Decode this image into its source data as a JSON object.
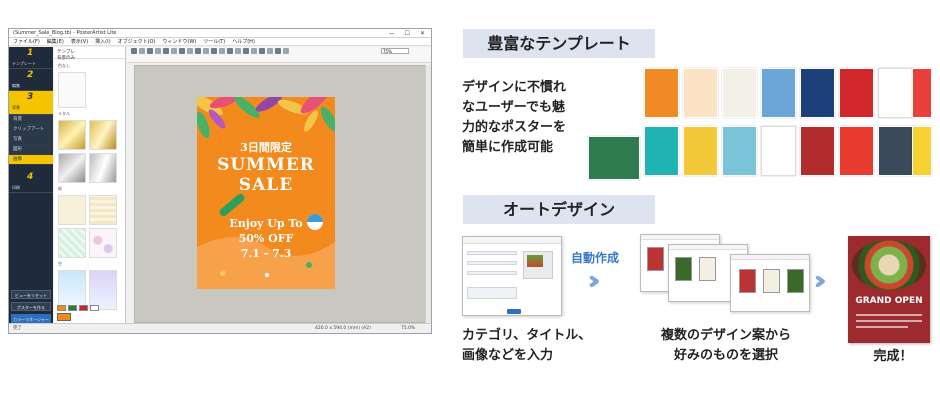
{
  "app": {
    "title": "(Summer_Sale_Blog.tb) - PosterArtist Lite",
    "menu": [
      "ファイル(F)",
      "編集(E)",
      "表示(V)",
      "挿入(I)",
      "オブジェクト(O)",
      "ウィンドウ(W)",
      "ツール(T)",
      "ヘルプ(H)"
    ],
    "zoom": "75%",
    "nav": {
      "steps": [
        {
          "num": "1",
          "label": "テンプレート"
        },
        {
          "num": "2",
          "label": "編集"
        },
        {
          "num": "3",
          "label": "背景"
        }
      ],
      "subitems": [
        "背景",
        "クリップアート",
        "写真",
        "図形",
        "画像"
      ],
      "step4": {
        "num": "4",
        "label": "印刷"
      },
      "bottom_buttons": [
        "ビューをリセット",
        "ポスターを作る",
        "カラーマネージャー"
      ]
    },
    "template_panel": {
      "header_line1": "テンプレ",
      "header_line2": "背景のみ",
      "caption_top": "色なし",
      "caption_metal": "メタル",
      "caption_paper": "紙",
      "caption_sky": "空",
      "panel_button": "その他の色",
      "color_label": "背景の色"
    },
    "status": {
      "left": "完了",
      "center": "420.0 x 594.0 (mm) (A2)",
      "right": "75.0%"
    }
  },
  "poster": {
    "days": "3日間限定",
    "summer": "SUMMER",
    "sale": "SALE",
    "enjoy": "Enjoy Up To",
    "off": "50% OFF",
    "date": "7.1 - 7.3",
    "bg_color": "#f28a1e"
  },
  "section1": {
    "heading": "豊富なテンプレート",
    "description_lines": [
      "デザインに不慣れ",
      "なユーザーでも魅",
      "力的なポスターを",
      "簡単に作成可能"
    ]
  },
  "section2": {
    "heading": "オートデザイン",
    "auto_label": "自動作成",
    "caption1_line1": "カテゴリ、タイトル、",
    "caption1_line2": "画像などを入力",
    "caption2_line1": "複数のデザイン案から",
    "caption2_line2": "好みのものを選択",
    "caption3": "完成！",
    "final_poster_title": "GRAND OPEN"
  },
  "colors": {
    "heading_bg": "#dde4ef",
    "accent_blue": "#3a78c8",
    "nav_bg": "#1f2b3a",
    "nav_active": "#f5c400"
  }
}
